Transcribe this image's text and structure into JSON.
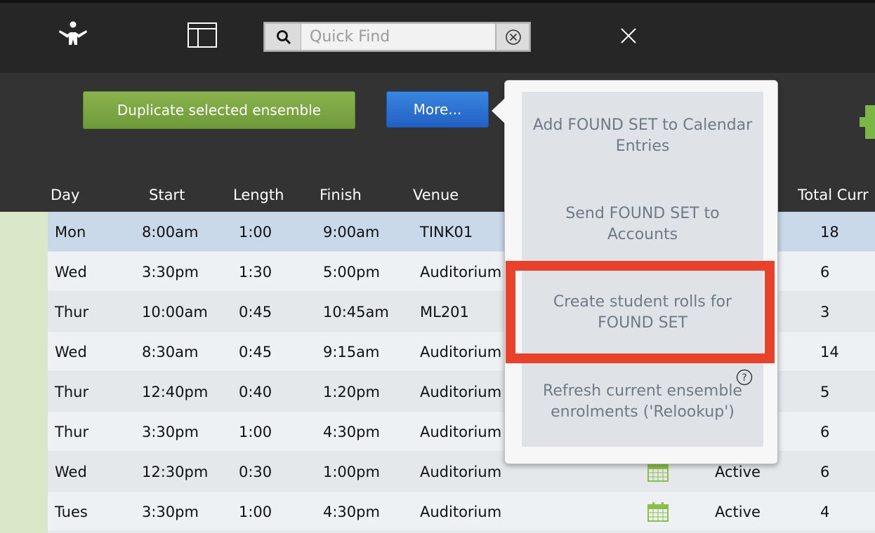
{
  "search": {
    "placeholder": "Quick Find"
  },
  "actions": {
    "duplicate_label": "Duplicate selected ensemble",
    "more_label": "More..."
  },
  "columns": {
    "day": "Day",
    "start": "Start",
    "length": "Length",
    "finish": "Finish",
    "venue": "Venue",
    "total": "Total Curr"
  },
  "rows": [
    {
      "day": "Mon",
      "start": "8:00am",
      "length": "1:00",
      "finish": "9:00am",
      "venue": "TINK01",
      "status": "",
      "total": "18"
    },
    {
      "day": "Wed",
      "start": "3:30pm",
      "length": "1:30",
      "finish": "5:00pm",
      "venue": "Auditorium",
      "status": "",
      "total": "6"
    },
    {
      "day": "Thur",
      "start": "10:00am",
      "length": "0:45",
      "finish": "10:45am",
      "venue": "ML201",
      "status": "",
      "total": "3"
    },
    {
      "day": "Wed",
      "start": "8:30am",
      "length": "0:45",
      "finish": "9:15am",
      "venue": "Auditorium",
      "status": "",
      "total": "14"
    },
    {
      "day": "Thur",
      "start": "12:40pm",
      "length": "0:40",
      "finish": "1:20pm",
      "venue": "Auditorium",
      "status": "",
      "total": "5"
    },
    {
      "day": "Thur",
      "start": "3:30pm",
      "length": "1:00",
      "finish": "4:30pm",
      "venue": "Auditorium",
      "status": "",
      "total": "6"
    },
    {
      "day": "Wed",
      "start": "12:30pm",
      "length": "0:30",
      "finish": "1:00pm",
      "venue": "Auditorium",
      "status": "Active",
      "total": "6"
    },
    {
      "day": "Tues",
      "start": "3:30pm",
      "length": "1:00",
      "finish": "4:30pm",
      "venue": "Auditorium",
      "status": "Active",
      "total": "4"
    }
  ],
  "menu": {
    "item1": "Add FOUND SET to Calendar Entries",
    "item2": "Send FOUND SET to Accounts",
    "item3": "Create student rolls for FOUND SET",
    "item4": "Refresh current ensemble enrolments ('Relookup')"
  },
  "colors": {
    "duplicate_button": "#7aa544",
    "more_button": "#2e6fd2",
    "highlight": "#e8432a",
    "calendar_icon": "#8cbf4a"
  }
}
